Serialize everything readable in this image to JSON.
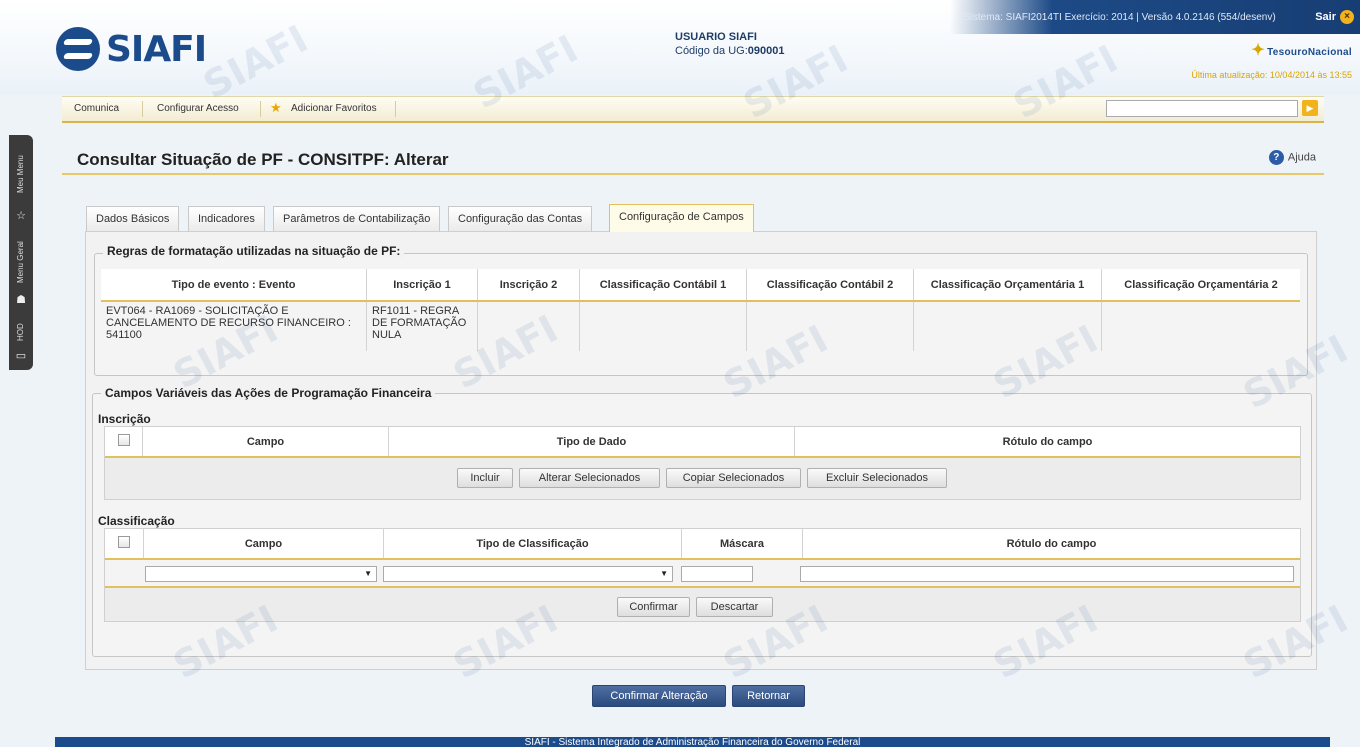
{
  "header": {
    "logo_text": "SIAFI",
    "system_info": "Sistema: SIAFI2014TI Exercício: 2014 | Versão 4.0.2146 (554/desenv)",
    "logout_label": "Sair",
    "user_label": "USUARIO SIAFI",
    "ug_label": "Código da UG:",
    "ug_code": "090001",
    "brand": "TesouroNacional",
    "last_update": "Última atualização: 10/04/2014 às 13:55"
  },
  "menu": {
    "items": [
      "Comunica",
      "Configurar Acesso",
      "Adicionar Favoritos"
    ],
    "search_placeholder": ""
  },
  "side_panel": {
    "items": [
      "Meu Menu",
      "Menu Geral",
      "HOD"
    ]
  },
  "page": {
    "title": "Consultar Situação de PF - CONSITPF: Alterar",
    "help_label": "Ajuda"
  },
  "tabs": [
    {
      "label": "Dados Básicos",
      "active": false
    },
    {
      "label": "Indicadores",
      "active": false
    },
    {
      "label": "Parâmetros de Contabilização",
      "active": false
    },
    {
      "label": "Configuração das Contas",
      "active": false
    },
    {
      "label": "Configuração de Campos",
      "active": true
    }
  ],
  "rules": {
    "legend": "Regras de formatação utilizadas na situação de PF:",
    "columns": [
      "Tipo de evento : Evento",
      "Inscrição 1",
      "Inscrição 2",
      "Classificação Contábil 1",
      "Classificação Contábil 2",
      "Classificação Orçamentária 1",
      "Classificação Orçamentária 2"
    ],
    "rows": [
      [
        "EVT064 - RA1069 - SOLICITAÇÃO E CANCELAMENTO DE RECURSO FINANCEIRO : 541100",
        "RF1011 - REGRA DE FORMATAÇÃO NULA",
        "",
        "",
        "",
        "",
        ""
      ]
    ]
  },
  "variable_fields": {
    "legend": "Campos Variáveis das Ações de Programação Financeira",
    "inscricao": {
      "title": "Inscrição",
      "columns": [
        "Campo",
        "Tipo de Dado",
        "Rótulo do campo"
      ],
      "buttons": [
        "Incluir",
        "Alterar Selecionados",
        "Copiar Selecionados",
        "Excluir Selecionados"
      ]
    },
    "classificacao": {
      "title": "Classificação",
      "columns": [
        "Campo",
        "Tipo de Classificação",
        "Máscara",
        "Rótulo do campo"
      ],
      "inputs": {
        "campo": "",
        "tipo": "",
        "mascara": "",
        "rotulo": ""
      },
      "buttons": [
        "Confirmar",
        "Descartar"
      ]
    }
  },
  "actions": {
    "confirm": "Confirmar Alteração",
    "back": "Retornar"
  },
  "footer": {
    "text": "SIAFI - Sistema Integrado de Administração Financeira do Governo Federal"
  },
  "colors": {
    "brand_blue": "#1c4b8c",
    "accent_gold": "#e0c15a",
    "primary_button": "#2b4a7e"
  }
}
